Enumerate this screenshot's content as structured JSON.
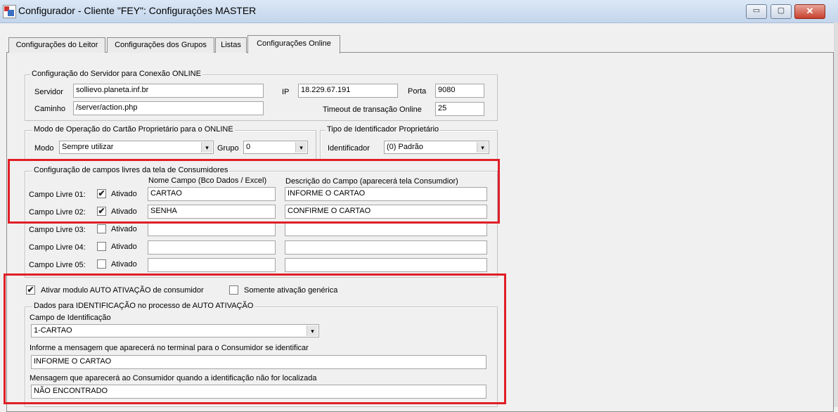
{
  "window": {
    "title": "Configurador - Cliente \"FEY\": Configurações MASTER",
    "minimize_glyph": "▭",
    "maximize_glyph": "▢",
    "close_glyph": "✕"
  },
  "tabs": [
    {
      "label": "Configurações do Leitor"
    },
    {
      "label": "Configurações dos Grupos"
    },
    {
      "label": "Listas"
    },
    {
      "label": "Configurações Online",
      "active": true
    }
  ],
  "server": {
    "legend": "Configuração do Servidor para Conexão ONLINE",
    "servidor_label": "Servidor",
    "servidor_value": "sollievo.planeta.inf.br",
    "caminho_label": "Caminho",
    "caminho_value": "/server/action.php",
    "ip_label": "IP",
    "ip_value": "18.229.67.191",
    "porta_label": "Porta",
    "porta_value": "9080",
    "timeout_label": "Timeout de transação Online",
    "timeout_value": "25"
  },
  "mode": {
    "legend": "Modo de Operação do Cartão Proprietário para o ONLINE",
    "modo_label": "Modo",
    "modo_value": "Sempre utilizar",
    "grupo_label": "Grupo",
    "grupo_value": "0"
  },
  "identifier": {
    "legend": "Tipo de Identificador Proprietário",
    "label": "Identificador",
    "value": "(0) Padrão"
  },
  "free_fields": {
    "legend": "Configuração de campos livres da tela de Consumidores",
    "col_name_header": "Nome Campo (Bco Dados / Excel)",
    "col_desc_header": "Descrição do Campo (aparecerá tela Consumdior)",
    "ativado_label": "Ativado",
    "rows": [
      {
        "label": "Campo Livre 01:",
        "checked": true,
        "name": "CARTAO",
        "desc": "INFORME O CARTAO"
      },
      {
        "label": "Campo Livre 02:",
        "checked": true,
        "name": "SENHA",
        "desc": "CONFIRME O CARTAO"
      },
      {
        "label": "Campo Livre 03:",
        "checked": false,
        "name": "",
        "desc": ""
      },
      {
        "label": "Campo Livre 04:",
        "checked": false,
        "name": "",
        "desc": ""
      },
      {
        "label": "Campo Livre 05:",
        "checked": false,
        "name": "",
        "desc": ""
      }
    ]
  },
  "auto_activation": {
    "enable_label": "Ativar modulo AUTO ATIVAÇÃO de consumidor",
    "enable_checked": true,
    "generic_label": "Somente ativação genérica",
    "generic_checked": false,
    "legend": "Dados para IDENTIFICAÇÃO no processo de AUTO ATIVAÇÃO",
    "campo_label": "Campo de Identificação",
    "campo_value": "1-CARTAO",
    "msg_label": "Informe a mensagem que aparecerá no terminal para o Consumidor se identificar",
    "msg_value": "INFORME O CARTAO",
    "notfound_label": "Mensagem que aparecerá ao Consumidor quando a identificação não for localizada",
    "notfound_value": "NÃO ENCONTRADO"
  },
  "check_glyph": "✔",
  "dropdown_glyph": "▾",
  "highlight_color": "#e01e26"
}
